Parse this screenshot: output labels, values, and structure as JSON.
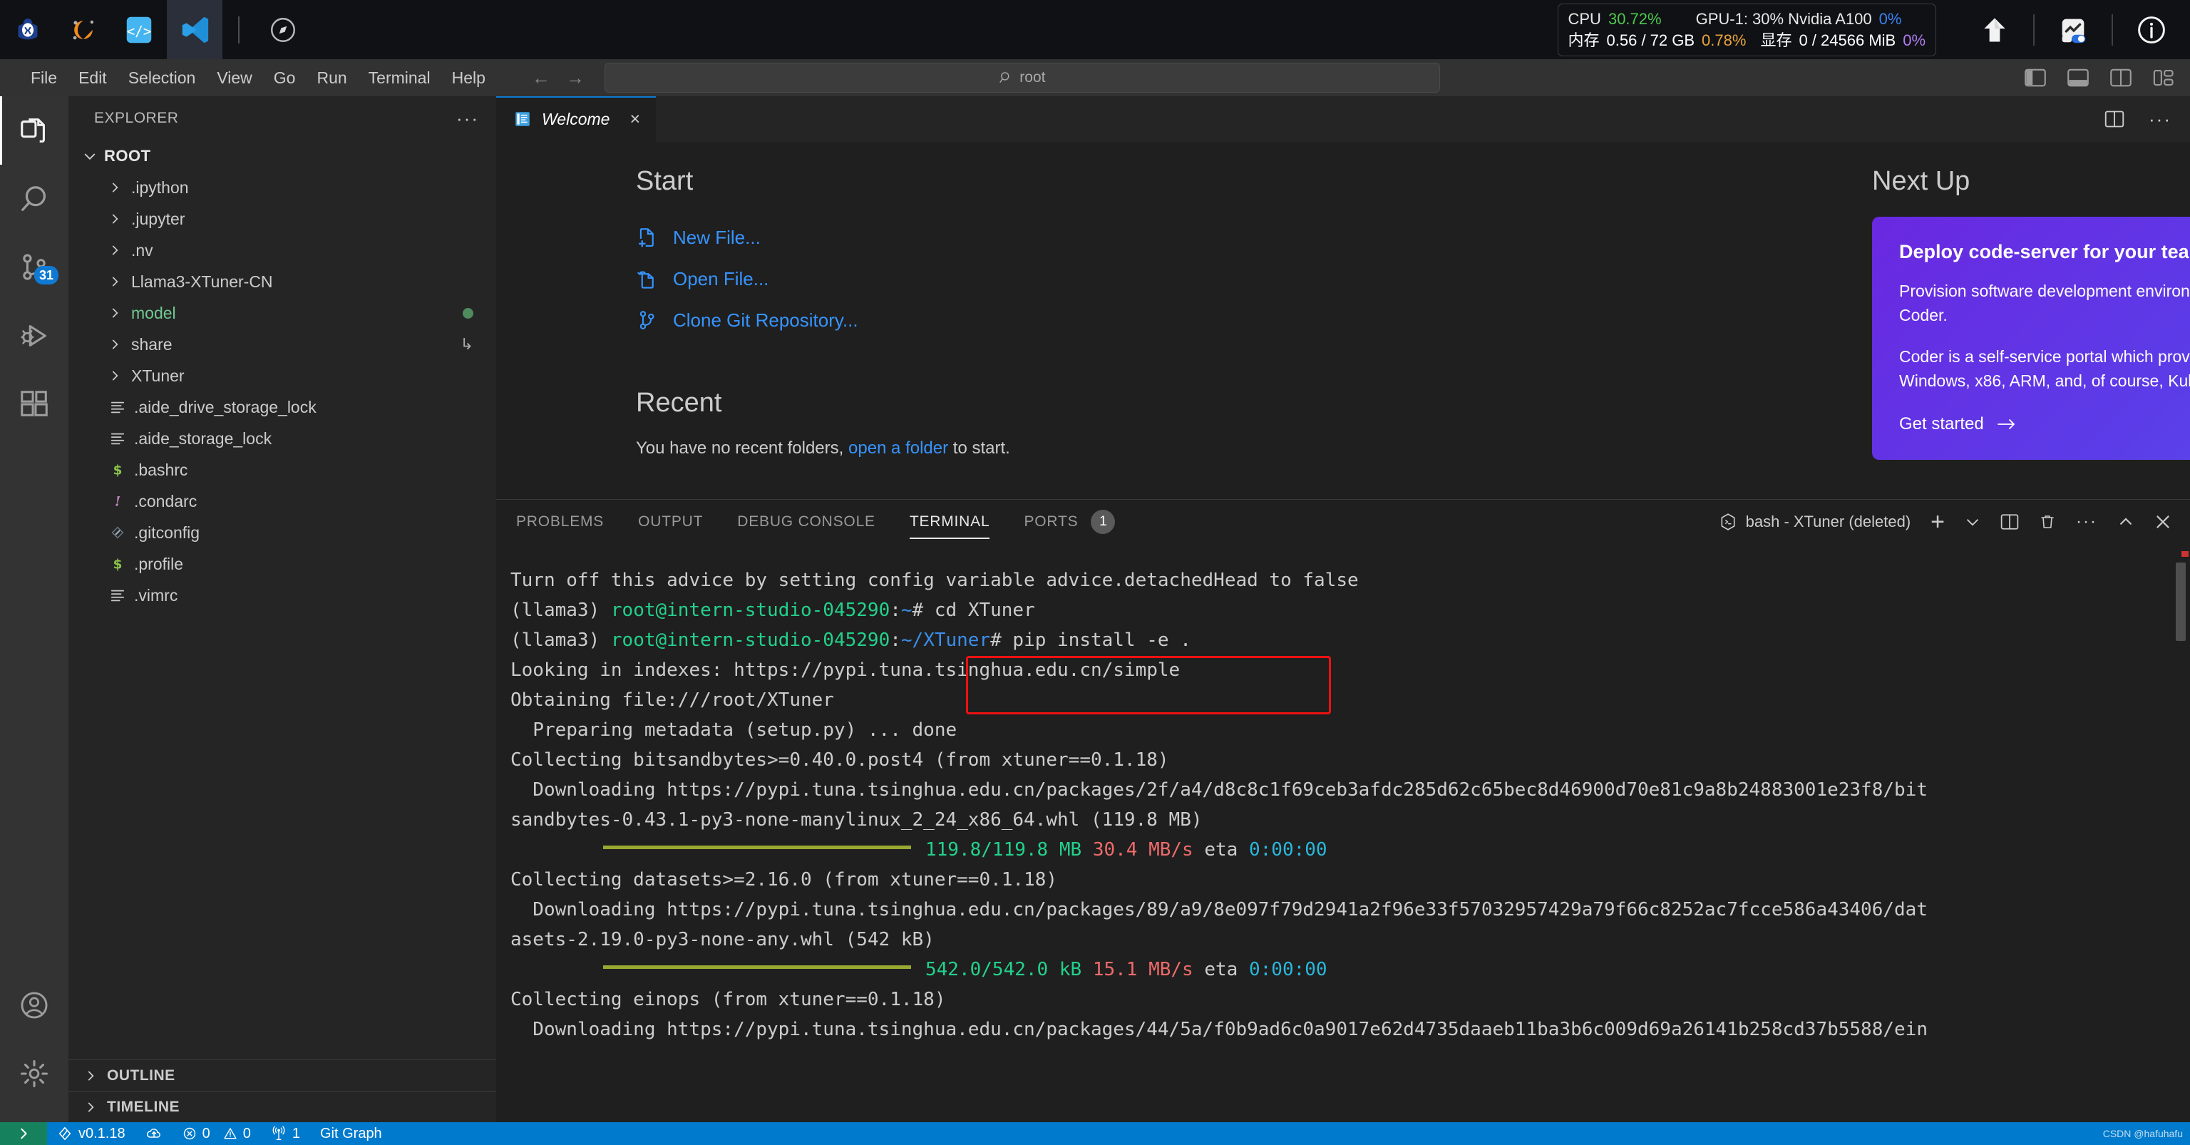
{
  "topbar": {
    "apps": [
      {
        "name": "intern-studio-logo",
        "label": ""
      },
      {
        "name": "conda-logo",
        "label": ""
      },
      {
        "name": "code-brackets-logo",
        "label": ""
      },
      {
        "name": "vscode-logo",
        "label": ""
      },
      {
        "name": "compass-logo",
        "label": ""
      }
    ],
    "sysmon": {
      "cpu_label": "CPU",
      "cpu_value": "30.72%",
      "mem_label": "内存",
      "mem_value": "0.56 / 72 GB",
      "mem_pct": "0.78%",
      "gpu_label": "GPU-1: 30% Nvidia A100",
      "gpu_pct": "0%",
      "vram_label": "显存",
      "vram_value": "0 / 24566 MiB",
      "vram_pct": "0%"
    },
    "right_icons": [
      "upload-icon",
      "monitor-toggle-icon",
      "info-icon"
    ]
  },
  "menubar": {
    "items": [
      "File",
      "Edit",
      "Selection",
      "View",
      "Go",
      "Run",
      "Terminal",
      "Help"
    ],
    "nav": {
      "back": "back-arrow-icon",
      "forward": "forward-arrow-icon"
    },
    "search": {
      "value": "root",
      "icon": "search-icon"
    },
    "layout_icons": [
      "toggle-primary-sidebar-icon",
      "toggle-panel-icon",
      "toggle-secondary-sidebar-icon",
      "customize-layout-icon"
    ]
  },
  "activitybar": {
    "items": [
      {
        "name": "explorer",
        "icon": "files-icon",
        "active": true,
        "badge": ""
      },
      {
        "name": "search",
        "icon": "search-icon",
        "active": false,
        "badge": ""
      },
      {
        "name": "source-control",
        "icon": "source-control-icon",
        "active": false,
        "badge": "31"
      },
      {
        "name": "run-and-debug",
        "icon": "debug-icon",
        "active": false,
        "badge": ""
      },
      {
        "name": "extensions",
        "icon": "extensions-icon",
        "active": false,
        "badge": ""
      }
    ],
    "bottom": [
      {
        "name": "accounts",
        "icon": "account-icon"
      },
      {
        "name": "settings",
        "icon": "gear-icon"
      }
    ]
  },
  "sidebar": {
    "title": "EXPLORER",
    "more_actions": "···",
    "root_label": "ROOT",
    "tree": [
      {
        "label": ".ipython",
        "type": "folder",
        "icon": "chevron-right-icon",
        "color": "default",
        "badge": ""
      },
      {
        "label": ".jupyter",
        "type": "folder",
        "icon": "chevron-right-icon",
        "color": "default",
        "badge": ""
      },
      {
        "label": ".nv",
        "type": "folder",
        "icon": "chevron-right-icon",
        "color": "default",
        "badge": ""
      },
      {
        "label": "Llama3-XTuner-CN",
        "type": "folder",
        "icon": "chevron-right-icon",
        "color": "default",
        "badge": ""
      },
      {
        "label": "model",
        "type": "folder",
        "icon": "chevron-right-icon",
        "color": "green",
        "badge": "dot"
      },
      {
        "label": "share",
        "type": "folder",
        "icon": "chevron-right-icon",
        "color": "default",
        "badge": "symlink"
      },
      {
        "label": "XTuner",
        "type": "folder",
        "icon": "chevron-right-icon",
        "color": "default",
        "badge": ""
      },
      {
        "label": ".aide_drive_storage_lock",
        "type": "file",
        "icon": "text-file-icon",
        "color": "default",
        "badge": ""
      },
      {
        "label": ".aide_storage_lock",
        "type": "file",
        "icon": "text-file-icon",
        "color": "default",
        "badge": ""
      },
      {
        "label": ".bashrc",
        "type": "file",
        "icon": "shell-file-icon",
        "color": "default",
        "badge": ""
      },
      {
        "label": ".condarc",
        "type": "file",
        "icon": "config-file-icon",
        "color": "default",
        "badge": ""
      },
      {
        "label": ".gitconfig",
        "type": "file",
        "icon": "git-file-icon",
        "color": "default",
        "badge": ""
      },
      {
        "label": ".profile",
        "type": "file",
        "icon": "shell-file-icon",
        "color": "default",
        "badge": ""
      },
      {
        "label": ".vimrc",
        "type": "file",
        "icon": "text-file-icon",
        "color": "default",
        "badge": ""
      }
    ],
    "sections": [
      {
        "label": "OUTLINE",
        "icon": "chevron-right-icon"
      },
      {
        "label": "TIMELINE",
        "icon": "chevron-right-icon"
      }
    ]
  },
  "editor": {
    "tabs": [
      {
        "label": "Welcome",
        "icon": "welcome-page-icon",
        "close": "×",
        "active": true
      }
    ],
    "actions": [
      "split-editor-icon",
      "more-actions-icon"
    ],
    "welcome": {
      "start_heading": "Start",
      "start_links": [
        {
          "label": "New File...",
          "icon": "new-file-icon"
        },
        {
          "label": "Open File...",
          "icon": "open-file-icon"
        },
        {
          "label": "Clone Git Repository...",
          "icon": "git-branch-icon"
        }
      ],
      "recent_heading": "Recent",
      "recent_text_pre": "You have no recent folders,",
      "recent_link": "open a folder",
      "recent_text_post": "to start.",
      "nextup_heading": "Next Up",
      "card": {
        "title": "Deploy code-server for your team",
        "body1": "Provision software development environments on your infrastructure with Coder.",
        "body2": "Coder is a self-service portal which provisions via Terraform—Linux, macOS, Windows, x86, ARM, and, of course, Kubernetes based infrastructure.",
        "cta": "Get started",
        "cta_icon": "arrow-right-icon",
        "gradient_from": "#6a28e0",
        "gradient_to": "#5d55f0"
      }
    }
  },
  "panel": {
    "tabs": [
      {
        "label": "PROBLEMS",
        "active": false,
        "badge": ""
      },
      {
        "label": "OUTPUT",
        "active": false,
        "badge": ""
      },
      {
        "label": "DEBUG CONSOLE",
        "active": false,
        "badge": ""
      },
      {
        "label": "TERMINAL",
        "active": true,
        "badge": ""
      },
      {
        "label": "PORTS",
        "active": false,
        "badge": "1"
      }
    ],
    "terminal_name": "bash - XTuner (deleted)",
    "terminal_icon": "terminal-bash-icon",
    "actions": [
      "new-terminal-icon",
      "chevron-down-icon",
      "split-terminal-icon",
      "kill-terminal-icon",
      "more-actions-icon",
      "maximize-panel-icon",
      "close-panel-icon"
    ]
  },
  "terminal": {
    "lines": [
      {
        "segments": [
          {
            "t": "Turn off this advice by setting config variable advice.detachedHead to false",
            "c": "grey"
          }
        ]
      },
      {
        "segments": [
          {
            "t": "",
            "c": "grey"
          }
        ]
      },
      {
        "segments": [
          {
            "t": "(llama3) ",
            "c": "grey"
          },
          {
            "t": "root@intern-studio-045290",
            "c": "green"
          },
          {
            "t": ":",
            "c": "grey"
          },
          {
            "t": "~",
            "c": "blue"
          },
          {
            "t": "# cd XTuner",
            "c": "grey"
          }
        ]
      },
      {
        "segments": [
          {
            "t": "(llama3) ",
            "c": "grey"
          },
          {
            "t": "root@intern-studio-045290",
            "c": "green"
          },
          {
            "t": ":",
            "c": "grey"
          },
          {
            "t": "~/XTuner",
            "c": "blue"
          },
          {
            "t": "# pip install -e .",
            "c": "grey"
          }
        ]
      },
      {
        "segments": [
          {
            "t": "Looking in indexes: https://pypi.tuna.tsinghua.edu.cn/simple",
            "c": "grey"
          }
        ]
      },
      {
        "segments": [
          {
            "t": "Obtaining file:///root/XTuner",
            "c": "grey"
          }
        ]
      },
      {
        "segments": [
          {
            "t": "  Preparing metadata (setup.py) ... done",
            "c": "grey"
          }
        ]
      },
      {
        "segments": [
          {
            "t": "Collecting bitsandbytes>=0.40.0.post4 (from xtuner==0.1.18)",
            "c": "grey"
          }
        ]
      },
      {
        "segments": [
          {
            "t": "  Downloading https://pypi.tuna.tsinghua.edu.cn/packages/2f/a4/d8c8c1f69ceb3afdc285d62c65bec8d46900d70e81c9a8b24883001e23f8/bit",
            "c": "grey"
          }
        ]
      },
      {
        "segments": [
          {
            "t": "sandbytes-0.43.1-py3-none-manylinux_2_24_x86_64.whl (119.8 MB)",
            "c": "grey"
          }
        ]
      },
      {
        "progress": true,
        "segments": [
          {
            "t": "119.8/119.8 MB",
            "c": "gr"
          },
          {
            "t": " ",
            "c": "grey"
          },
          {
            "t": "30.4 MB/s",
            "c": "red"
          },
          {
            "t": " eta ",
            "c": "grey"
          },
          {
            "t": "0:00:00",
            "c": "cyan"
          }
        ]
      },
      {
        "segments": [
          {
            "t": "Collecting datasets>=2.16.0 (from xtuner==0.1.18)",
            "c": "grey"
          }
        ]
      },
      {
        "segments": [
          {
            "t": "  Downloading https://pypi.tuna.tsinghua.edu.cn/packages/89/a9/8e097f79d2941a2f96e33f57032957429a79f66c8252ac7fcce586a43406/dat",
            "c": "grey"
          }
        ]
      },
      {
        "segments": [
          {
            "t": "asets-2.19.0-py3-none-any.whl (542 kB)",
            "c": "grey"
          }
        ]
      },
      {
        "progress": true,
        "segments": [
          {
            "t": "542.0/542.0 kB",
            "c": "gr"
          },
          {
            "t": " ",
            "c": "grey"
          },
          {
            "t": "15.1 MB/s",
            "c": "red"
          },
          {
            "t": " eta ",
            "c": "grey"
          },
          {
            "t": "0:00:00",
            "c": "cyan"
          }
        ]
      },
      {
        "segments": [
          {
            "t": "Collecting einops (from xtuner==0.1.18)",
            "c": "grey"
          }
        ]
      },
      {
        "segments": [
          {
            "t": "  Downloading https://pypi.tuna.tsinghua.edu.cn/packages/44/5a/f0b9ad6c0a9017e62d4735daaeb11ba3b6c009d69a26141b258cd37b5588/ein",
            "c": "grey"
          }
        ]
      }
    ]
  },
  "statusbar": {
    "remote_icon": "remote-window-icon",
    "cells": [
      {
        "name": "version",
        "icon": "xtuner-icon",
        "label": "v0.1.18"
      },
      {
        "name": "sync",
        "icon": "cloud-upload-icon",
        "label": ""
      },
      {
        "name": "errors",
        "icon": "error-icon",
        "label": "0"
      },
      {
        "name": "warnings",
        "icon": "warning-icon",
        "label": "0"
      },
      {
        "name": "radio-tower",
        "icon": "radio-tower-icon",
        "label": "1"
      },
      {
        "name": "git-graph",
        "icon": "",
        "label": "Git Graph"
      }
    ],
    "watermark": "CSDN @hafuhafu"
  }
}
